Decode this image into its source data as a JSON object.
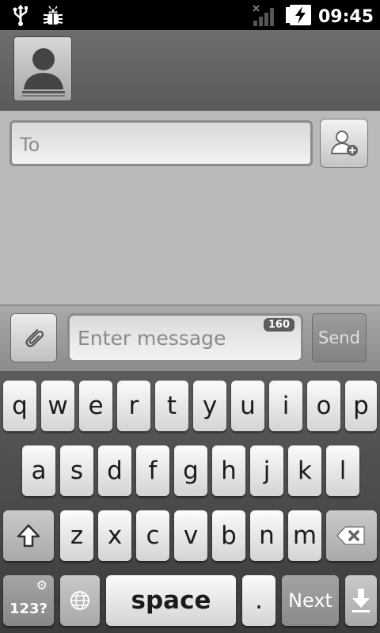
{
  "status_bar": {
    "time": "09:45",
    "icons": [
      "usb-icon",
      "debug-bug-icon",
      "signal-icon",
      "battery-charging-icon"
    ]
  },
  "header": {
    "avatar_icon": "contact-silhouette-icon"
  },
  "recipients": {
    "to_placeholder": "To",
    "add_contact_icon": "add-contact-icon"
  },
  "compose": {
    "attach_icon": "paperclip-icon",
    "message_placeholder": "Enter message",
    "char_counter": "160",
    "send_label": "Send"
  },
  "keyboard": {
    "row1": [
      "q",
      "w",
      "e",
      "r",
      "t",
      "y",
      "u",
      "i",
      "o",
      "p"
    ],
    "row2": [
      "a",
      "s",
      "d",
      "f",
      "g",
      "h",
      "j",
      "k",
      "l"
    ],
    "row3": [
      "z",
      "x",
      "c",
      "v",
      "b",
      "n",
      "m"
    ],
    "symbols_label": "123?",
    "space_label": "space",
    "period_label": ".",
    "next_label": "Next",
    "shift_icon": "shift-icon",
    "delete_icon": "backspace-icon",
    "globe_icon": "globe-icon",
    "settings_icon": "gear-icon",
    "hide_icon": "hide-keyboard-icon"
  },
  "colors": {
    "status_bar_bg": "#000000",
    "header_bg": "#666666",
    "recipients_bg": "#b9b9b9",
    "keyboard_bg": "#4a4a4a"
  }
}
